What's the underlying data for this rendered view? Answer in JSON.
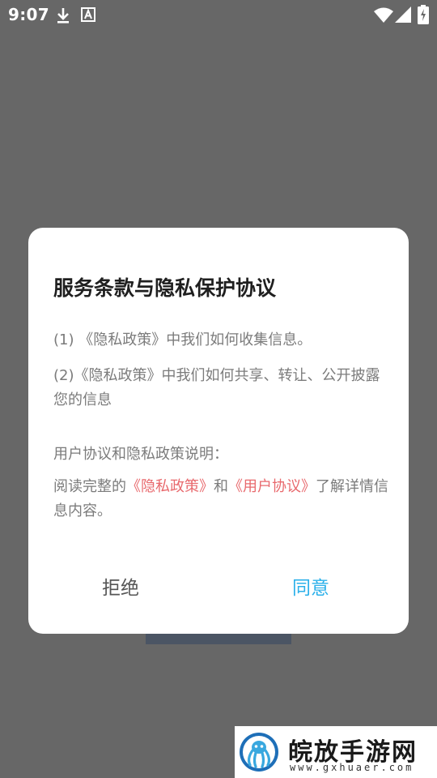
{
  "status_bar": {
    "time": "9:07",
    "icons": [
      "download-icon",
      "text-a-icon",
      "wifi-icon",
      "signal-icon",
      "battery-charging-icon"
    ]
  },
  "dialog": {
    "title": "服务条款与隐私保护协议",
    "item1": "(1) 《隐私政策》中我们如何收集信息。",
    "item2": "(2)《隐私政策》中我们如何共享、转让、公开披露您的信息",
    "section_heading": "用户协议和隐私政策说明：",
    "read_prefix": "阅读完整的",
    "privacy_link": "《隐私政策》",
    "and_text": "和",
    "user_agreement_link": "《用户协议》",
    "read_suffix": "了解详情信息内容。",
    "refuse_button": "拒绝",
    "agree_button": "同意"
  },
  "watermark": {
    "title": "皖放手游网",
    "url": "www.gxhuaer.com"
  },
  "colors": {
    "overlay": "#676767",
    "link": "#e8696d",
    "agree": "#2bb0ea"
  }
}
